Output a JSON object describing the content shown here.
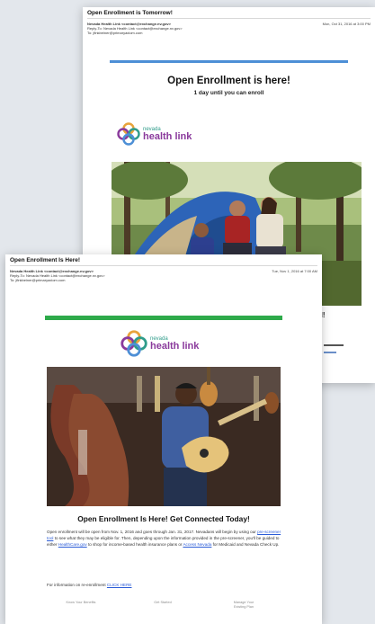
{
  "back_email": {
    "subject": "Open Enrollment is Tomorrow!",
    "from": "Nevada Health Link <contact@exchange.nv.gov>",
    "reply_to": "Reply-To: Nevada Health Link <contact@exchange.nv.gov>",
    "to": "To: jfinkbeiner@primaryaxiom.com",
    "date": "Mon, Oct 31, 2016 at 3:00 PM",
    "headline": "Open Enrollment is here!",
    "subhead": "1 day until you can enroll",
    "logo_small": "nevada",
    "logo_big": "health link",
    "side_fragment": "d!"
  },
  "front_email": {
    "subject": "Open Enrollment Is Here!",
    "from": "Nevada Health Link <contact@exchange.nv.gov>",
    "reply_to": "Reply-To: Nevada Health Link <contact@exchange.nv.gov>",
    "to": "To: jfinkbeiner@primaryaxiom.com",
    "date": "Tue, Nov 1, 2016 at 7:00 AM",
    "logo_small": "nevada",
    "logo_big": "health link",
    "headline": "Open Enrollment Is Here! Get Connected Today!",
    "body_1": "Open enrollment will be open from Nov. 1, 2016 and goes through Jan. 31, 2017. Nevadans will begin by using our ",
    "link_1": "pre-screener tool",
    "body_2": " to see what they may be eligible for. Then, depending upon the information provided in the pre-screener, you'll be guided to either ",
    "link_2": "HealthCare.gov",
    "body_3": " to shop for income-based health insurance plans or ",
    "link_3": "Access Nevada",
    "body_4": " for Medicaid and Nevada Check Up.",
    "reenroll_text": "For information on re-enrollment ",
    "reenroll_link": "CLICK HERE",
    "footer": {
      "col1": "Know Your Benefits",
      "col2": "Get Started",
      "col3_line1": "Manage Your",
      "col3_line2": "Existing Plan"
    }
  },
  "colors": {
    "back_accent": "#4d8fd6",
    "front_accent": "#2eaa4a",
    "logo_purple": "#8a3a9c",
    "logo_teal": "#2f9c8a",
    "link": "#2a5bd7"
  }
}
